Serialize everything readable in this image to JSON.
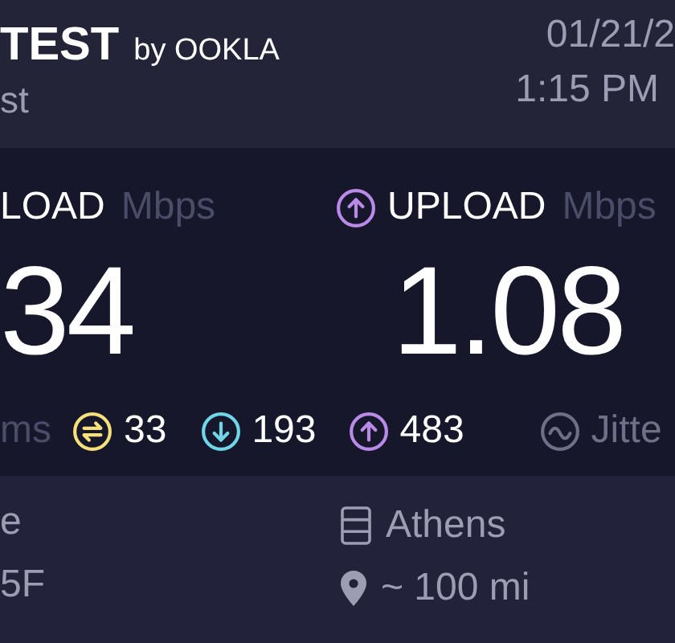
{
  "header": {
    "brand": "TEST",
    "brand_suffix": "by OOKLA",
    "subtitle": "st",
    "date": "01/21/2",
    "time": "1:15 PM"
  },
  "results": [
    {
      "kind": "download",
      "label": "LOAD",
      "unit": "Mbps",
      "value": "34"
    },
    {
      "kind": "upload",
      "label": "UPLOAD",
      "unit": "Mbps",
      "value": "1.08"
    }
  ],
  "metrics": [
    {
      "kind": "unit",
      "text": "ms"
    },
    {
      "kind": "idle",
      "text": "33"
    },
    {
      "kind": "download",
      "text": "193"
    },
    {
      "kind": "upload",
      "text": "483"
    },
    {
      "kind": "jitter",
      "text": "Jitte"
    }
  ],
  "connection": {
    "provider_lines": [
      "e",
      "5F"
    ],
    "server": "Athens",
    "distance": "~ 100 mi"
  }
}
